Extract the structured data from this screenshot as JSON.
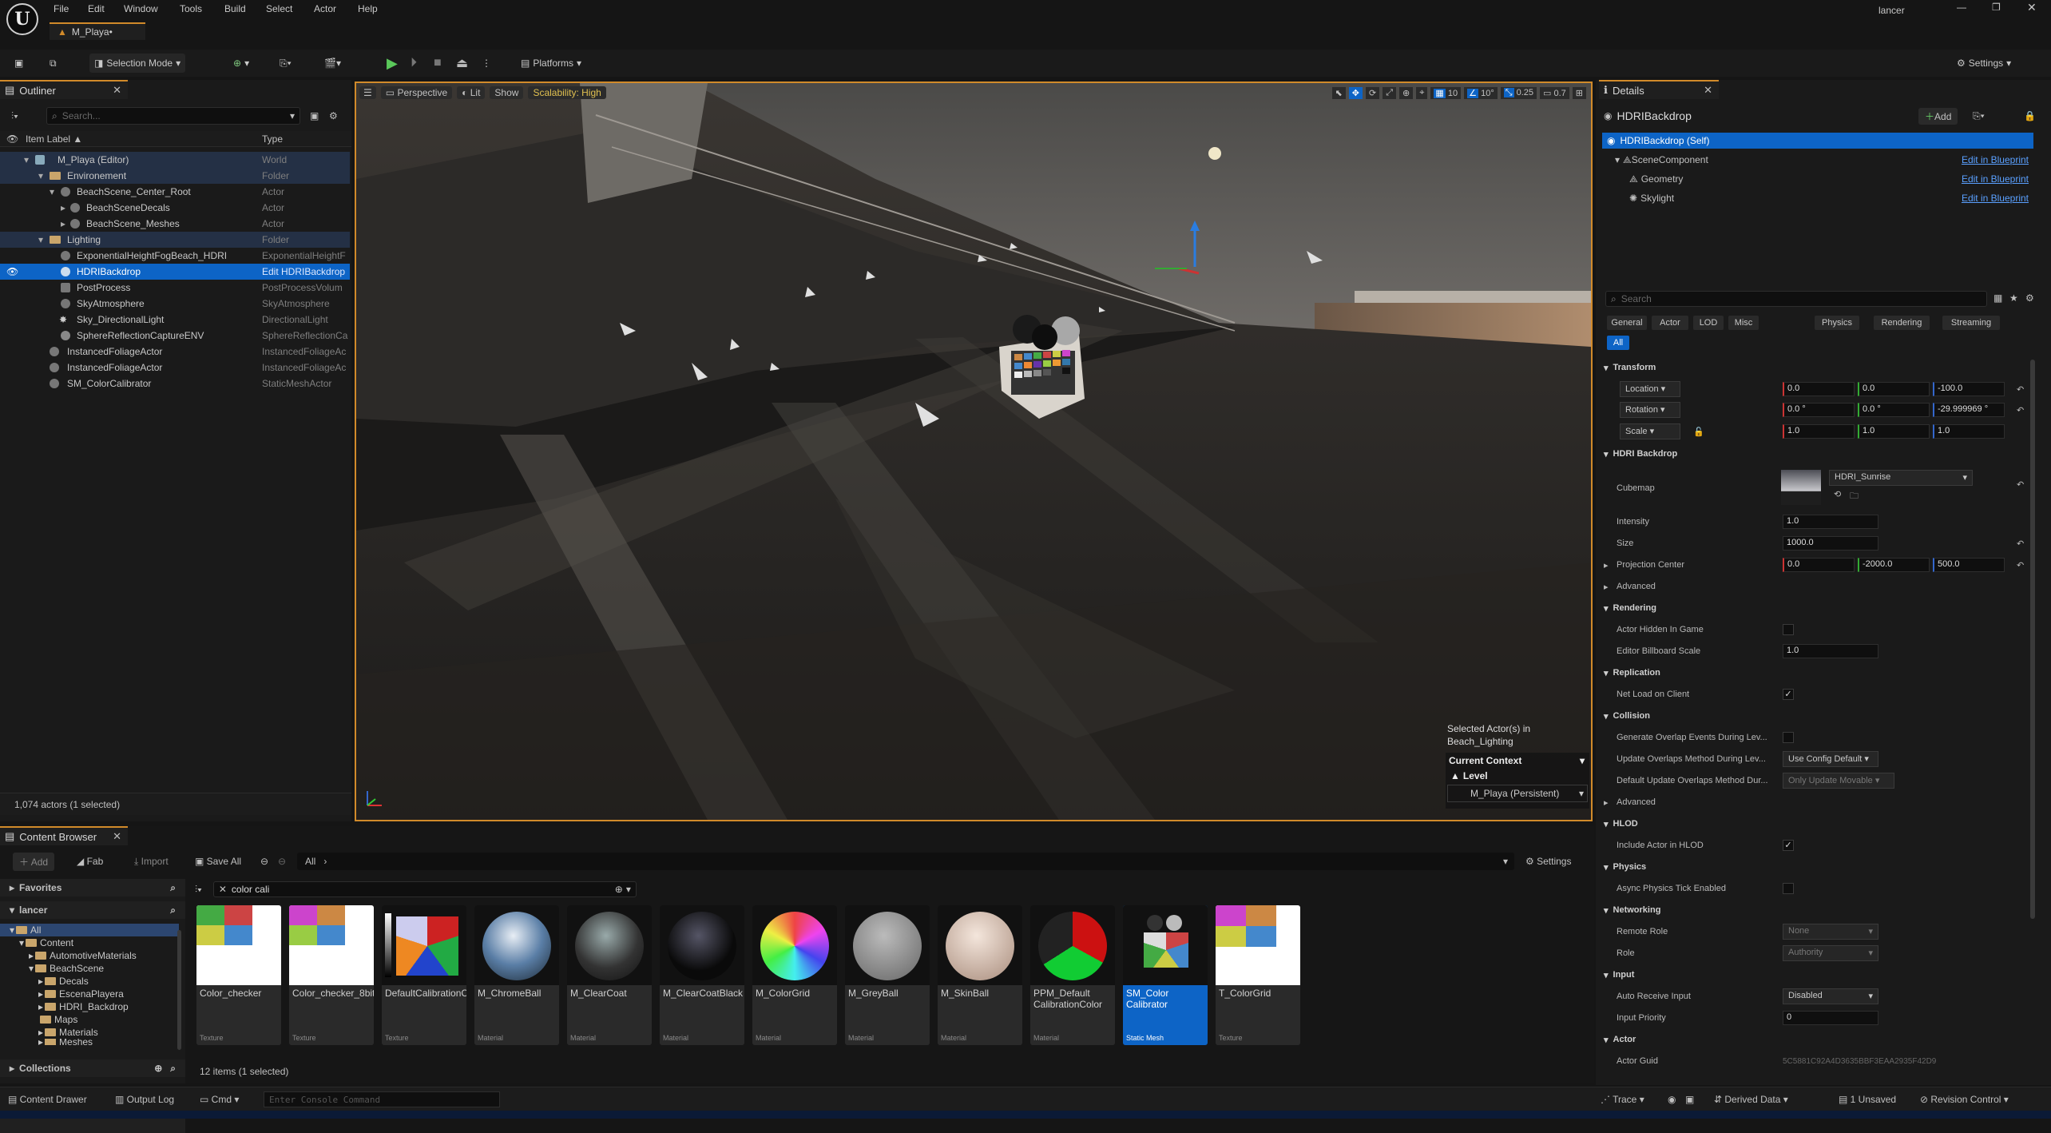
{
  "menu": [
    "File",
    "Edit",
    "Window",
    "Tools",
    "Build",
    "Select",
    "Actor",
    "Help"
  ],
  "user": "lancer",
  "doc_tab": "M_Playa•",
  "toolbar": {
    "selection_mode": "Selection Mode",
    "platforms": "Platforms",
    "settings": "Settings"
  },
  "outliner": {
    "tab": "Outliner",
    "search_placeholder": "Search...",
    "col_label": "Item Label ▲",
    "col_type": "Type",
    "rows": [
      {
        "label": "M_Playa (Editor)",
        "type": "World"
      },
      {
        "label": "Environement",
        "type": "Folder"
      },
      {
        "label": "BeachScene_Center_Root",
        "type": "Actor"
      },
      {
        "label": "BeachSceneDecals",
        "type": "Actor"
      },
      {
        "label": "BeachScene_Meshes",
        "type": "Actor"
      },
      {
        "label": "Lighting",
        "type": "Folder"
      },
      {
        "label": "ExponentialHeightFogBeach_HDRI",
        "type": "ExponentialHeightF"
      },
      {
        "label": "HDRIBackdrop",
        "type": "Edit HDRIBackdrop"
      },
      {
        "label": "PostProcess",
        "type": "PostProcessVolum"
      },
      {
        "label": "SkyAtmosphere",
        "type": "SkyAtmosphere"
      },
      {
        "label": "Sky_DirectionalLight",
        "type": "DirectionalLight"
      },
      {
        "label": "SphereReflectionCaptureENV",
        "type": "SphereReflectionCa"
      },
      {
        "label": "InstancedFoliageActor",
        "type": "InstancedFoliageAc"
      },
      {
        "label": "InstancedFoliageActor",
        "type": "InstancedFoliageAc"
      },
      {
        "label": "SM_ColorCalibrator",
        "type": "StaticMeshActor"
      }
    ],
    "footer": "1,074 actors (1 selected)"
  },
  "viewport": {
    "perspective": "Perspective",
    "lit": "Lit",
    "show": "Show",
    "scalability": "Scalability: High",
    "grid_snap": "10",
    "rot_snap": "10°",
    "scale_snap": "0.25",
    "cam_speed": "0.7",
    "selected_info_1": "Selected Actor(s) in",
    "selected_info_2": "Beach_Lighting",
    "current_context": "Current Context",
    "level_label": "Level",
    "level_value": "M_Playa (Persistent)"
  },
  "details": {
    "tab": "Details",
    "actor_name": "HDRIBackdrop",
    "add": "Add",
    "self": "HDRIBackdrop (Self)",
    "components": [
      {
        "name": "SceneComponent",
        "link": "Edit in Blueprint"
      },
      {
        "name": "Geometry",
        "link": "Edit in Blueprint"
      },
      {
        "name": "Skylight",
        "link": "Edit in Blueprint"
      }
    ],
    "search_placeholder": "Search",
    "categories": [
      "General",
      "Actor",
      "LOD",
      "Misc",
      "Physics",
      "Rendering",
      "Streaming"
    ],
    "all": "All",
    "transform": {
      "title": "Transform",
      "location": "Location",
      "loc": [
        "0.0",
        "0.0",
        "-100.0"
      ],
      "rotation": "Rotation",
      "rot": [
        "0.0 °",
        "0.0 °",
        "-29.999969 °"
      ],
      "scale": "Scale",
      "scl": [
        "1.0",
        "1.0",
        "1.0"
      ]
    },
    "hdri": {
      "title": "HDRI Backdrop",
      "cubemap": "Cubemap",
      "cubemap_value": "HDRI_Sunrise",
      "intensity": "Intensity",
      "intensity_value": "1.0",
      "size": "Size",
      "size_value": "1000.0",
      "projection": "Projection Center",
      "proj": [
        "0.0",
        "-2000.0",
        "500.0"
      ],
      "advanced": "Advanced"
    },
    "rendering": {
      "title": "Rendering",
      "hidden": "Actor Hidden In Game",
      "billboard": "Editor Billboard Scale",
      "billboard_value": "1.0"
    },
    "replication": {
      "title": "Replication",
      "net_load": "Net Load on Client"
    },
    "collision": {
      "title": "Collision",
      "gen_overlap": "Generate Overlap Events During Lev...",
      "update_overlap": "Update Overlaps Method During Lev...",
      "update_overlap_value": "Use Config Default",
      "default_update": "Default Update Overlaps Method Dur...",
      "default_update_value": "Only Update Movable",
      "advanced": "Advanced"
    },
    "hlod": {
      "title": "HLOD",
      "include": "Include Actor in HLOD"
    },
    "physics": {
      "title": "Physics",
      "async": "Async Physics Tick Enabled"
    },
    "networking": {
      "title": "Networking",
      "remote_role": "Remote Role",
      "remote_role_value": "None",
      "role": "Role",
      "role_value": "Authority"
    },
    "input": {
      "title": "Input",
      "auto_receive": "Auto Receive Input",
      "auto_receive_value": "Disabled",
      "priority": "Input Priority",
      "priority_value": "0"
    },
    "actor": {
      "title": "Actor",
      "guid": "Actor Guid",
      "guid_value": "5C5881C92A4D3635BBF3EAA2935F42D9"
    }
  },
  "content_browser": {
    "tab": "Content Browser",
    "add": "Add",
    "fab": "Fab",
    "import": "Import",
    "save_all": "Save All",
    "path": "All",
    "settings": "Settings",
    "favorites": "Favorites",
    "root": "lancer",
    "filter_text": "color cali",
    "tree": [
      "All",
      "Content",
      "AutomotiveMaterials",
      "BeachScene",
      "Decals",
      "EscenaPlayera",
      "HDRI_Backdrop",
      "Maps",
      "Materials",
      "Meshes"
    ],
    "collections": "Collections",
    "items_count": "12 items (1 selected)",
    "assets": [
      {
        "name": "Color_checker",
        "type": "Texture"
      },
      {
        "name": "Color_checker_8bit",
        "type": "Texture"
      },
      {
        "name": "DefaultCalibrationColor",
        "type": "Texture"
      },
      {
        "name": "M_ChromeBall",
        "type": "Material"
      },
      {
        "name": "M_ClearCoat",
        "type": "Material"
      },
      {
        "name": "M_ClearCoatBlack",
        "type": "Material"
      },
      {
        "name": "M_ColorGrid",
        "type": "Material"
      },
      {
        "name": "M_GreyBall",
        "type": "Material"
      },
      {
        "name": "M_SkinBall",
        "type": "Material"
      },
      {
        "name": "PPM_Default CalibrationColor",
        "type": "Material"
      },
      {
        "name": "SM_Color Calibrator",
        "type": "Static Mesh"
      },
      {
        "name": "T_ColorGrid",
        "type": "Texture"
      }
    ]
  },
  "statusbar": {
    "content_drawer": "Content Drawer",
    "output_log": "Output Log",
    "cmd": "Cmd",
    "console_placeholder": "Enter Console Command",
    "trace": "Trace",
    "derived_data": "Derived Data",
    "unsaved": "1 Unsaved",
    "revision": "Revision Control"
  },
  "colors": {
    "accent": "#0d64c6",
    "selection_orange": "#d18a2a",
    "link": "#5aa0ff"
  }
}
